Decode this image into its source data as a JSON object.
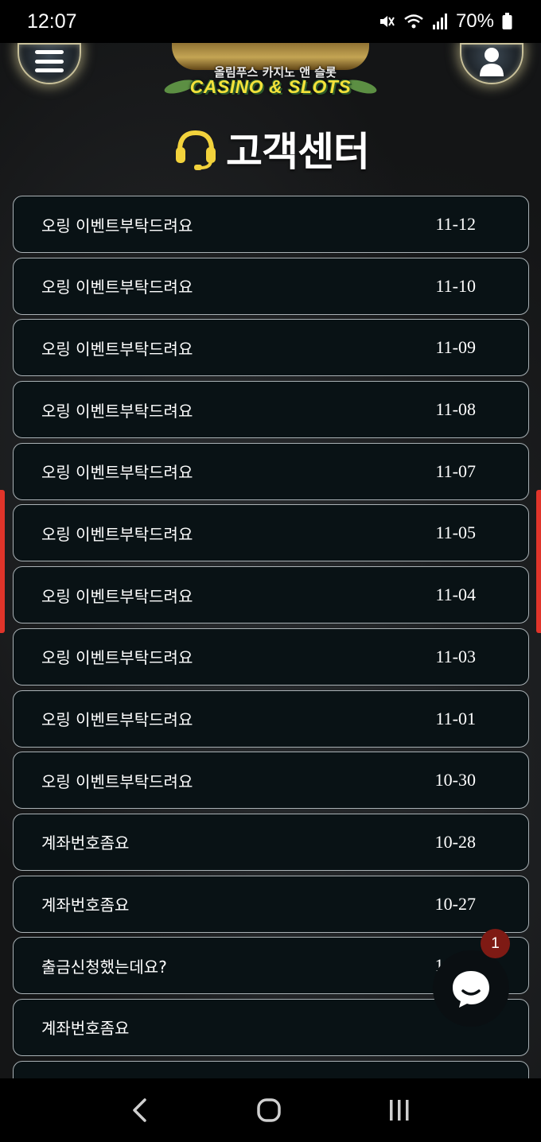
{
  "status_bar": {
    "time": "12:07",
    "battery": "70%",
    "icons": [
      "mute-icon",
      "wifi-icon",
      "signal-icon",
      "battery-icon"
    ]
  },
  "header": {
    "logo_sub": "올림푸스 카지노 앤 슬롯",
    "logo_main": "CASINO & SLOTS",
    "menu_icon": "hamburger-icon",
    "profile_icon": "user-icon"
  },
  "page": {
    "title": "고객센터",
    "title_icon": "headset-icon"
  },
  "tickets": [
    {
      "title": "오링 이벤트부탁드려요",
      "date": "11-12"
    },
    {
      "title": "오링 이벤트부탁드려요",
      "date": "11-10"
    },
    {
      "title": "오링 이벤트부탁드려요",
      "date": "11-09"
    },
    {
      "title": "오링 이벤트부탁드려요",
      "date": "11-08"
    },
    {
      "title": "오링 이벤트부탁드려요",
      "date": "11-07"
    },
    {
      "title": "오링 이벤트부탁드려요",
      "date": "11-05"
    },
    {
      "title": "오링 이벤트부탁드려요",
      "date": "11-04"
    },
    {
      "title": "오링 이벤트부탁드려요",
      "date": "11-03"
    },
    {
      "title": "오링 이벤트부탁드려요",
      "date": "11-01"
    },
    {
      "title": "오링 이벤트부탁드려요",
      "date": "10-30"
    },
    {
      "title": "계좌번호좀요",
      "date": "10-28"
    },
    {
      "title": "계좌번호좀요",
      "date": "10-27"
    },
    {
      "title": "출금신청했는데요?",
      "date": "10-26"
    },
    {
      "title": "계좌번호좀요",
      "date": ""
    },
    {
      "title": "",
      "date": ""
    }
  ],
  "chat": {
    "badge_count": "1",
    "icon": "chat-bubble-icon"
  },
  "nav_bar": {
    "icons": [
      "back-icon",
      "home-icon",
      "recents-icon"
    ]
  },
  "colors": {
    "accent_side": "#e0342a",
    "row_bg": "#091215",
    "row_border": "#a9b1b5",
    "badge": "#7e1a14",
    "headset": "#f2d23c"
  }
}
